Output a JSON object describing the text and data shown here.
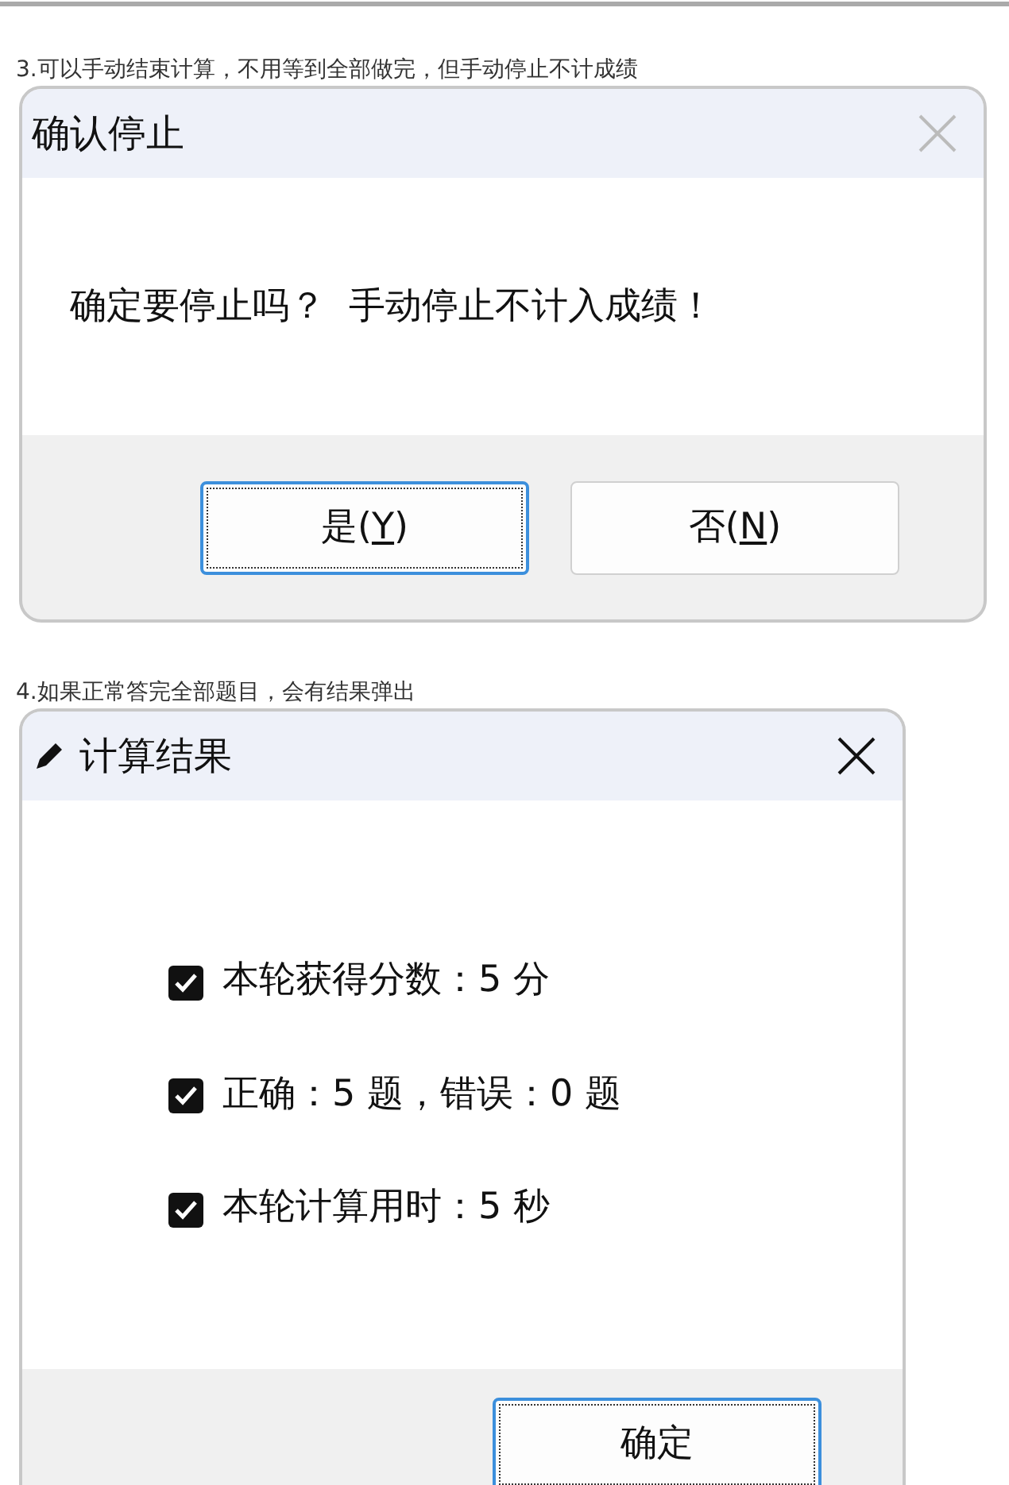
{
  "sections": [
    {
      "caption": "3.可以手动结束计算，不用等到全部做完，但手动停止不计成绩",
      "dialog": {
        "title": "确认停止",
        "icon": false,
        "close_enabled": false,
        "kind": "message",
        "message": "确定要停止吗？  手动停止不计入成绩！",
        "buttons": [
          {
            "before": "是(",
            "access_key": "Y",
            "after": ")",
            "focused": true
          },
          {
            "before": "否(",
            "access_key": "N",
            "after": ")",
            "focused": false
          }
        ]
      }
    },
    {
      "caption": "4.如果正常答完全部题目，会有结果弹出",
      "dialog": {
        "title": "计算结果",
        "icon": true,
        "close_enabled": true,
        "kind": "checklist",
        "items": [
          {
            "label": "本轮获得分数：5 分",
            "checked": true
          },
          {
            "label": "正确：5 题，错误：0 题",
            "checked": true
          },
          {
            "label": "本轮计算用时：5 秒",
            "checked": true
          }
        ],
        "buttons": [
          {
            "before": "确定",
            "focused": true
          }
        ]
      }
    }
  ]
}
